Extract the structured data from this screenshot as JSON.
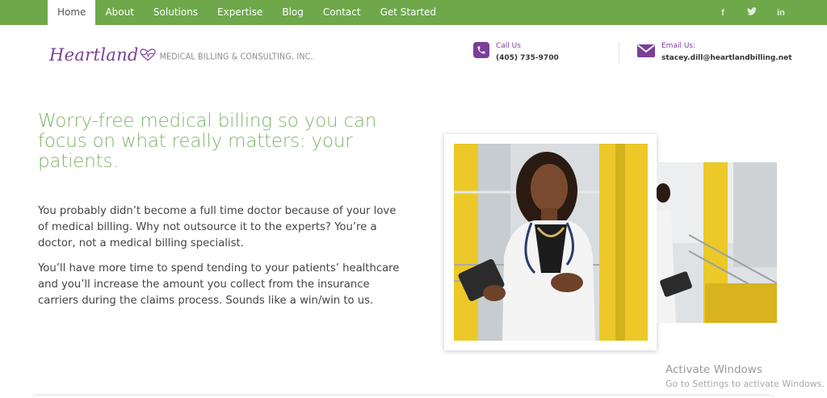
{
  "nav": {
    "items": [
      "Home",
      "About",
      "Solutions",
      "Expertise",
      "Blog",
      "Contact",
      "Get Started"
    ],
    "active_index": 0,
    "social": [
      {
        "name": "facebook-icon",
        "glyph": "f"
      },
      {
        "name": "twitter-icon",
        "glyph": "𝕥"
      },
      {
        "name": "linkedin-icon",
        "glyph": "in"
      }
    ],
    "background_color": "#6ea84b"
  },
  "logo": {
    "script_text": "Heartland",
    "tagline": "MEDICAL BILLING & CONSULTING, INC.",
    "brand_color": "#7b3f98"
  },
  "contact": {
    "call_label": "Call Us",
    "call_value": "(405) 735-9700",
    "email_label": "Email Us:",
    "email_value": "stacey.dill@heartlandbilling.net"
  },
  "hero": {
    "headline": "Worry-free medical billing so you can focus on what really matters: your patients.",
    "paragraph1": "You probably didn’t become a full time doctor because of your love of medical billing. Why not outsource it to the experts? You’re a doctor, not a medical billing specialist.",
    "paragraph2": "You’ll have more time to spend tending to your patients’ healthcare and you’ll increase the amount you collect from the insurance carriers during the claims process. Sounds like a win/win to us.",
    "headline_color": "#7fb56a"
  },
  "watermark": {
    "title": "Activate Windows",
    "subtitle": "Go to Settings to activate Windows."
  }
}
